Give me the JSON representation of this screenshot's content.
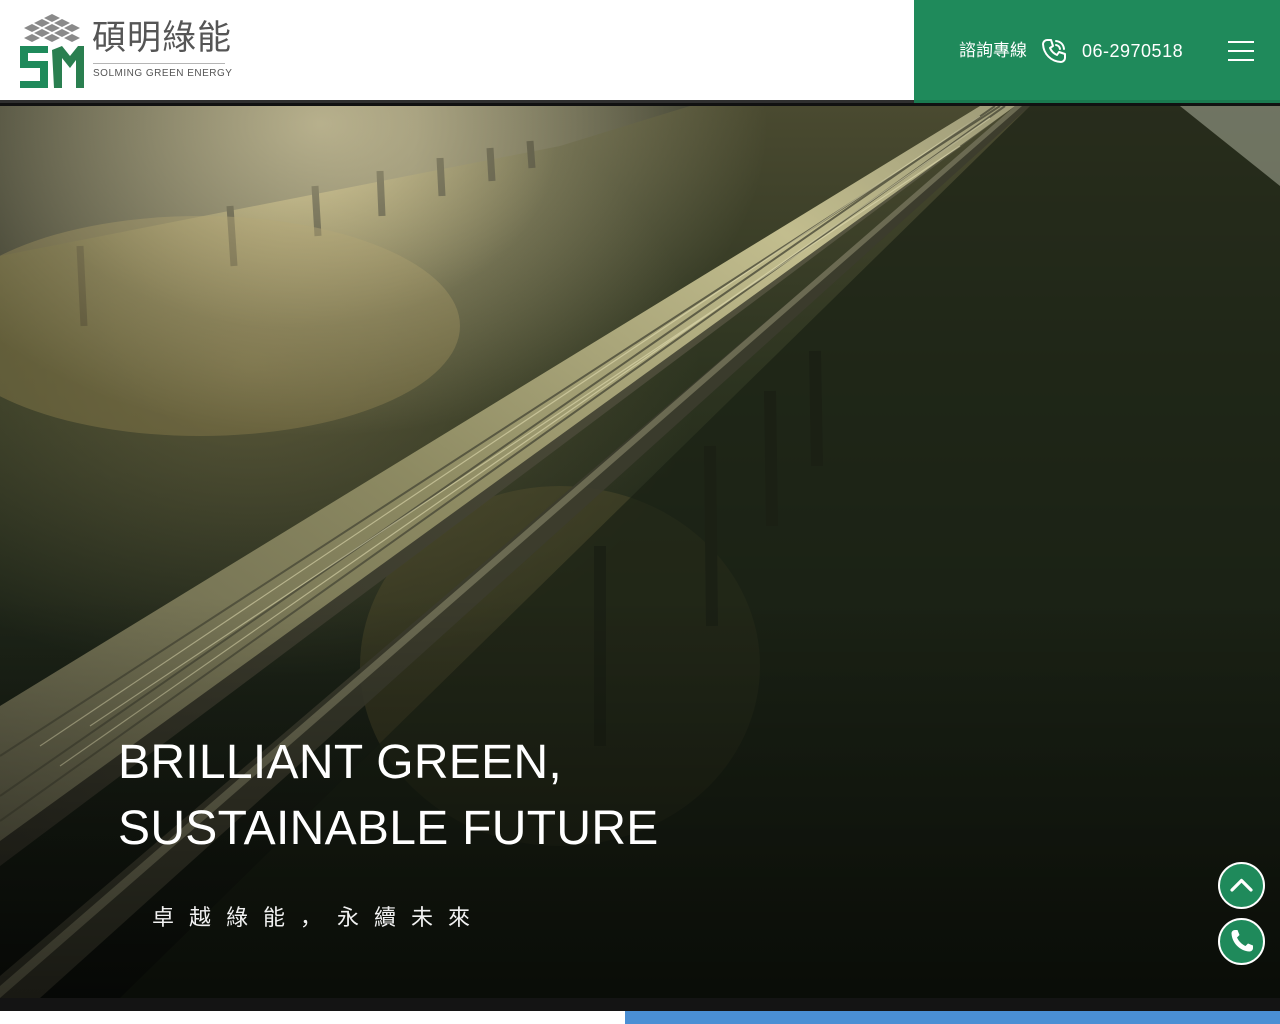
{
  "header": {
    "logo": {
      "name_cn": "碩明綠能",
      "name_en": "SOLMING GREEN ENERGY",
      "mark_letters": "SM"
    },
    "contact": {
      "label": "諮詢專線",
      "phone": "06-2970518",
      "phone_icon": "phone-icon"
    },
    "menu_icon": "hamburger-menu-icon"
  },
  "hero": {
    "title_line1": "BRILLIANT GREEN,",
    "title_line2": "SUSTAINABLE FUTURE",
    "subtitle": "卓越綠能，永續未來"
  },
  "floating": {
    "top_icon": "chevron-up-icon",
    "call_icon": "phone-icon"
  },
  "colors": {
    "brand_green": "#1f8a5b",
    "logo_gray": "#555555",
    "strip_blue": "#4a8fd4"
  }
}
